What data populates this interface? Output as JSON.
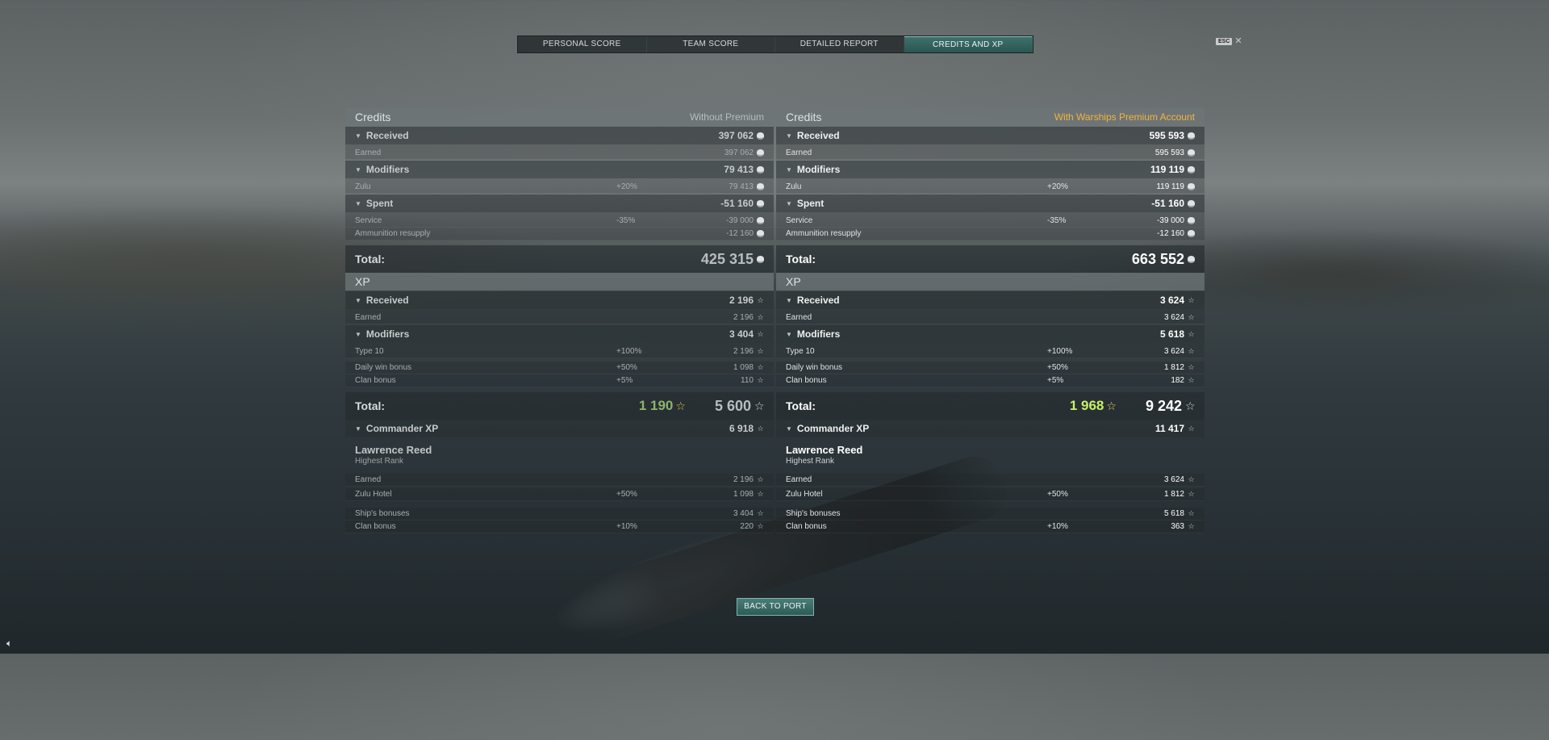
{
  "tabs": [
    {
      "label": "PERSONAL SCORE"
    },
    {
      "label": "TEAM SCORE"
    },
    {
      "label": "DETAILED REPORT"
    },
    {
      "label": "CREDITS AND XP"
    }
  ],
  "esc": {
    "key": "ESC",
    "close": "✕"
  },
  "panels": {
    "left": {
      "credits_title": "Credits",
      "mode": "Without Premium",
      "received": "397 062",
      "earned": "397 062",
      "modifiers": "79 413",
      "zulu_pct": "+20%",
      "zulu": "79 413",
      "spent": "-51 160",
      "service_pct": "-35%",
      "service": "-39 000",
      "ammo": "-12 160",
      "credits_total": "425 315",
      "xp_title": "XP",
      "xp_received": "2 196",
      "xp_earned": "2 196",
      "xp_modifiers": "3 404",
      "type10_pct": "+100%",
      "type10": "2 196",
      "daily_pct": "+50%",
      "daily": "1 098",
      "clan_pct": "+5%",
      "clan": "110",
      "xp_free": "1 190",
      "xp_total": "5 600",
      "cmdr_xp": "6 918",
      "cmdr_earned": "2 196",
      "hotel_pct": "+50%",
      "hotel": "1 098",
      "ships_bonus": "3 404",
      "cmdr_clan_pct": "+10%",
      "cmdr_clan": "220"
    },
    "right": {
      "credits_title": "Credits",
      "mode": "With Warships Premium Account",
      "received": "595 593",
      "earned": "595 593",
      "modifiers": "119 119",
      "zulu_pct": "+20%",
      "zulu": "119 119",
      "spent": "-51 160",
      "service_pct": "-35%",
      "service": "-39 000",
      "ammo": "-12 160",
      "credits_total": "663 552",
      "xp_title": "XP",
      "xp_received": "3 624",
      "xp_earned": "3 624",
      "xp_modifiers": "5 618",
      "type10_pct": "+100%",
      "type10": "3 624",
      "daily_pct": "+50%",
      "daily": "1 812",
      "clan_pct": "+5%",
      "clan": "182",
      "xp_free": "1 968",
      "xp_total": "9 242",
      "cmdr_xp": "11 417",
      "cmdr_earned": "3 624",
      "hotel_pct": "+50%",
      "hotel": "1 812",
      "ships_bonus": "5 618",
      "cmdr_clan_pct": "+10%",
      "cmdr_clan": "363"
    }
  },
  "labels": {
    "received": "Received",
    "earned": "Earned",
    "modifiers": "Modifiers",
    "zulu": "Zulu",
    "spent": "Spent",
    "service": "Service",
    "ammo": "Ammunition resupply",
    "total": "Total:",
    "type10": "Type 10",
    "daily": "Daily win bonus",
    "clan": "Clan bonus",
    "cmdr_xp": "Commander XP",
    "cmdr_name": "Lawrence Reed",
    "cmdr_rank": "Highest Rank",
    "hotel": "Zulu Hotel",
    "ships": "Ship's bonuses"
  },
  "back_button": "BACK TO PORT",
  "icons": {
    "credit": "credit-icon",
    "xp": "star-icon",
    "sound": "speaker-icon"
  }
}
